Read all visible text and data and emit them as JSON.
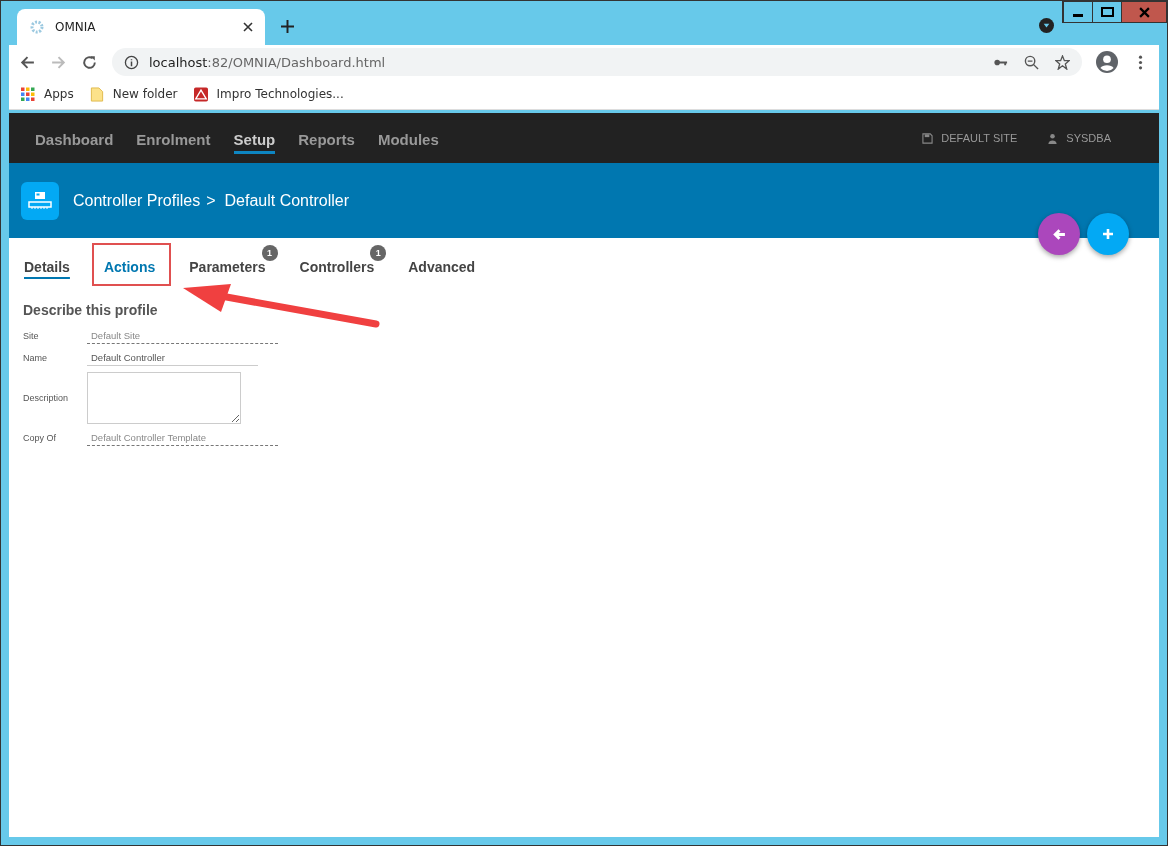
{
  "browser": {
    "tab_title": "OMNIA",
    "url_host": "localhost",
    "url_path": ":82/OMNIA/Dashboard.html",
    "bookmarks": [
      {
        "kind": "apps",
        "label": "Apps"
      },
      {
        "kind": "folder",
        "label": "New folder"
      },
      {
        "kind": "site",
        "label": "Impro Technologies..."
      }
    ]
  },
  "nav": {
    "items": [
      {
        "label": "Dashboard",
        "selected": false
      },
      {
        "label": "Enrolment",
        "selected": false
      },
      {
        "label": "Setup",
        "selected": true
      },
      {
        "label": "Reports",
        "selected": false
      },
      {
        "label": "Modules",
        "selected": false
      }
    ],
    "site": "DEFAULT SITE",
    "user": "SYSDBA"
  },
  "header": {
    "breadcrumb": "Controller Profiles",
    "separator": ">",
    "title": "Default Controller"
  },
  "tabs": [
    {
      "label": "Details",
      "selected": true,
      "annotated": false
    },
    {
      "label": "Actions",
      "selected": false,
      "annotated": true
    },
    {
      "label": "Parameters",
      "selected": false,
      "annotated": false,
      "badge": "1"
    },
    {
      "label": "Controllers",
      "selected": false,
      "annotated": false,
      "badge": "1"
    },
    {
      "label": "Advanced",
      "selected": false,
      "annotated": false
    }
  ],
  "form": {
    "heading": "Describe this profile",
    "fields": [
      {
        "kind": "readonly",
        "label": "Site",
        "value": "Default Site"
      },
      {
        "kind": "text",
        "label": "Name",
        "value": "Default Controller"
      },
      {
        "kind": "textarea",
        "label": "Description"
      },
      {
        "kind": "readonly",
        "label": "Copy Of",
        "value": "Default Controller Template"
      }
    ]
  }
}
